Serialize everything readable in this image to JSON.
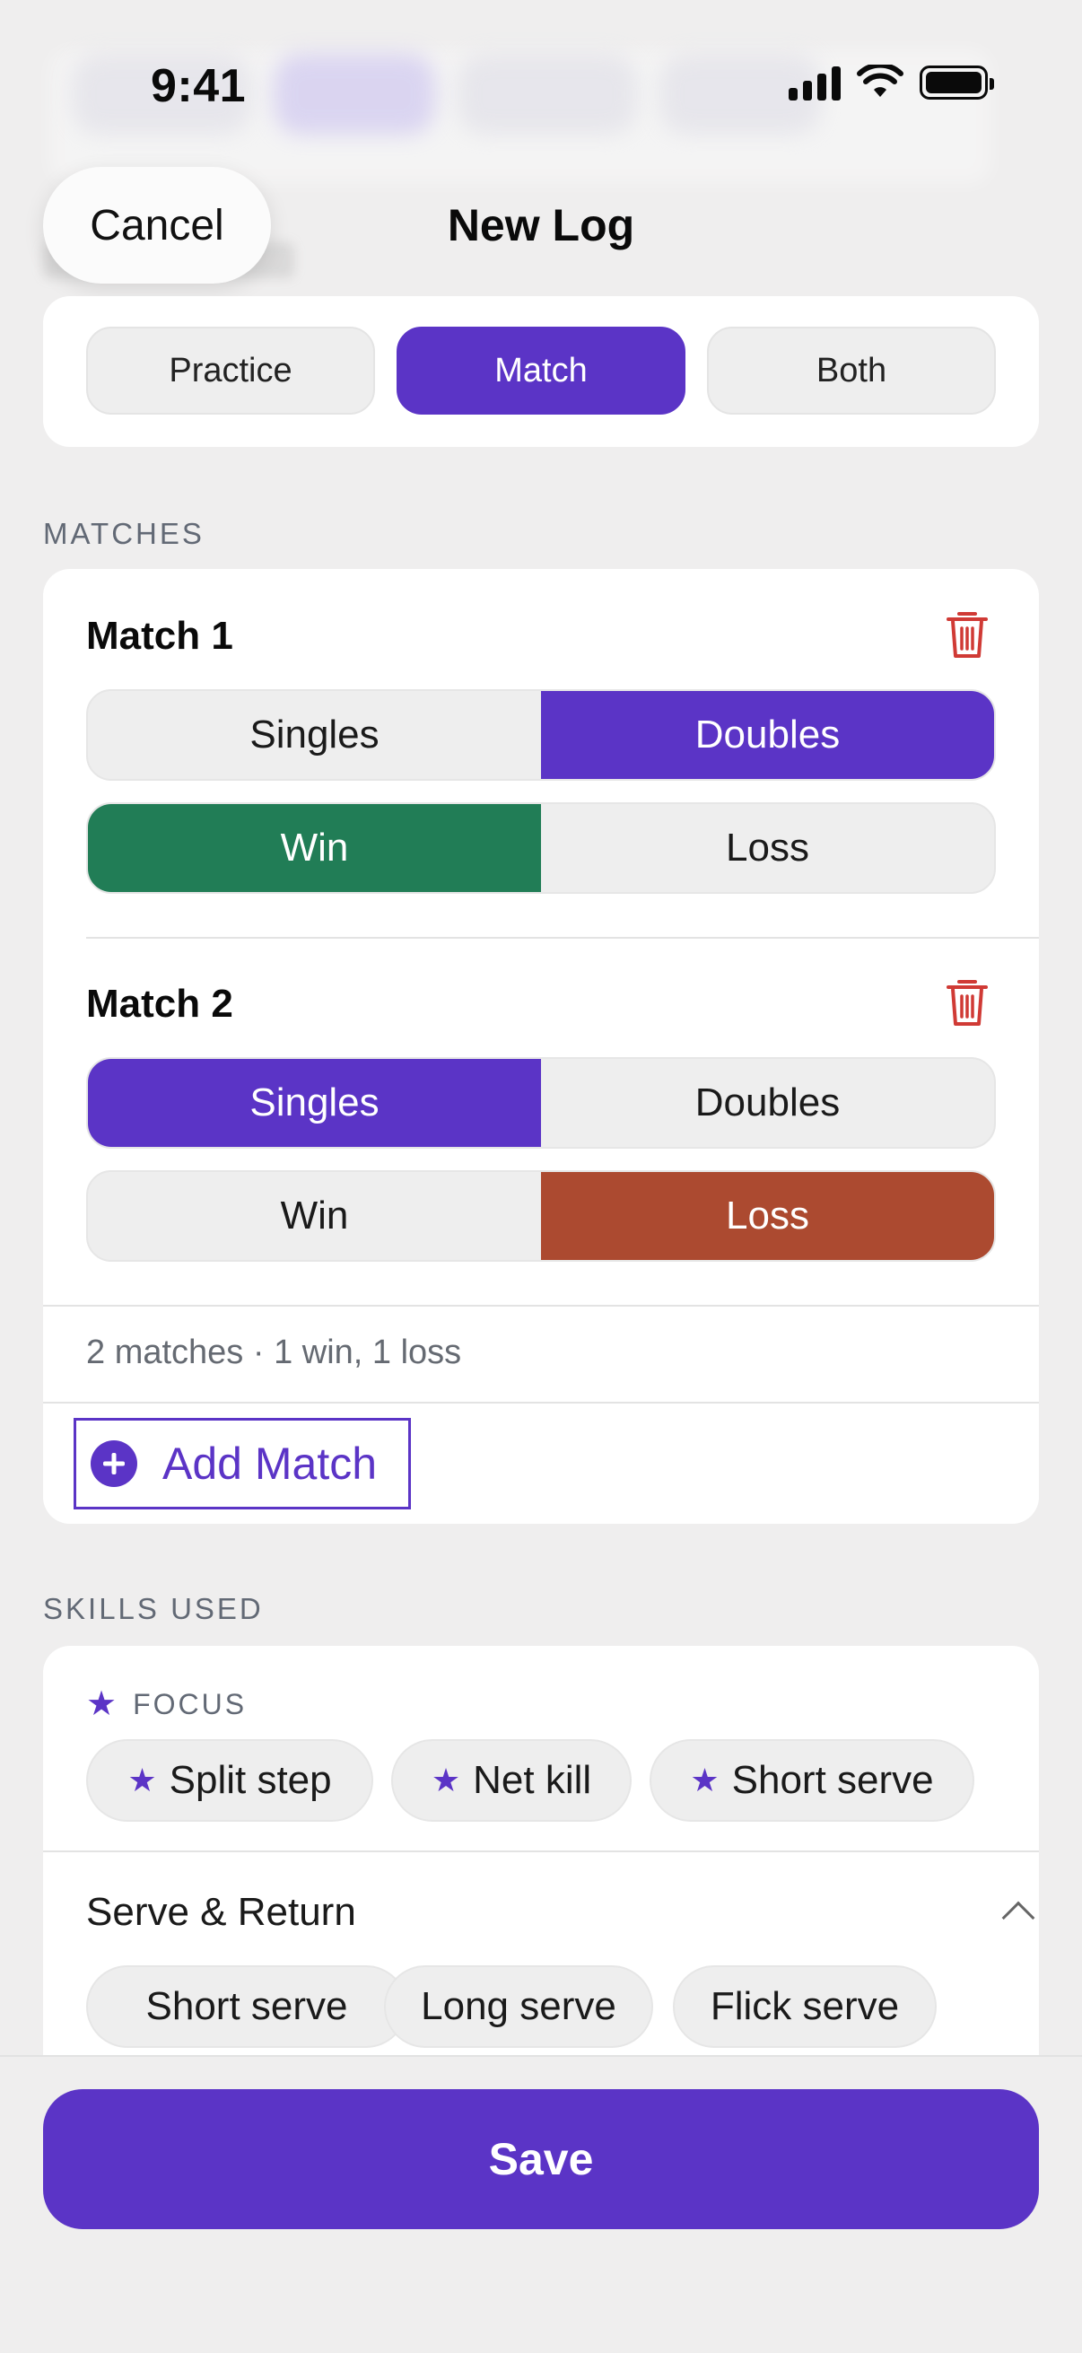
{
  "status_bar": {
    "time": "9:41"
  },
  "nav": {
    "cancel_label": "Cancel",
    "title": "New Log"
  },
  "session_type": {
    "options": [
      "Practice",
      "Match",
      "Both"
    ],
    "selected": "Match"
  },
  "matches": {
    "section_label": "MATCHES",
    "items": [
      {
        "title": "Match 1",
        "format_options": [
          "Singles",
          "Doubles"
        ],
        "format_selected": "Doubles",
        "result_options": [
          "Win",
          "Loss"
        ],
        "result_selected": "Win"
      },
      {
        "title": "Match 2",
        "format_options": [
          "Singles",
          "Doubles"
        ],
        "format_selected": "Singles",
        "result_options": [
          "Win",
          "Loss"
        ],
        "result_selected": "Loss"
      }
    ],
    "summary": "2 matches · 1 win, 1 loss",
    "add_label": "Add Match"
  },
  "skills": {
    "section_label": "SKILLS USED",
    "focus_label": "FOCUS",
    "focus_chips": [
      "Split step",
      "Net kill",
      "Short serve"
    ],
    "group_title": "Serve & Return",
    "group_chips": [
      "Short serve",
      "Long serve",
      "Flick serve"
    ]
  },
  "save_label": "Save",
  "colors": {
    "accent": "#5b34c6",
    "win": "#217d56",
    "loss": "#ac4a30",
    "destructive": "#d03a35"
  },
  "icons": {
    "delete": "trash-icon",
    "add": "plus-circle-icon",
    "focus": "star-icon",
    "collapse": "chevron-up-icon"
  }
}
